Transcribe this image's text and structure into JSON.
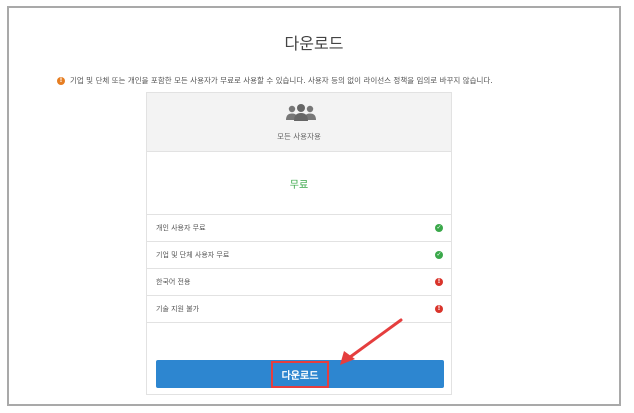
{
  "page": {
    "title": "다운로드",
    "notice": "기업 및 단체 또는 개인을 포함한 모든 사용자가 무료로 사용할 수 있습니다. 사용자 등의 없이 라이선스 정책을 임의로 바꾸지 않습니다."
  },
  "card": {
    "audience": "모든 사용자용",
    "price": "무료",
    "features": [
      {
        "label": "개인 사용자 무료",
        "status": "ok"
      },
      {
        "label": "기업 및 단체 사용자 무료",
        "status": "ok"
      },
      {
        "label": "한국어 전용",
        "status": "no"
      },
      {
        "label": "기술 지원 불가",
        "status": "no"
      }
    ],
    "download_label": "다운로드"
  },
  "icons": {
    "notice": "warning-icon",
    "audience": "users-icon",
    "ok": "check-circle-icon",
    "no": "exclamation-circle-icon"
  },
  "colors": {
    "accent": "#2d86d0",
    "ok": "#3aa84a",
    "no": "#d9342b",
    "warning": "#e67e22",
    "highlight": "#e53e3e"
  }
}
